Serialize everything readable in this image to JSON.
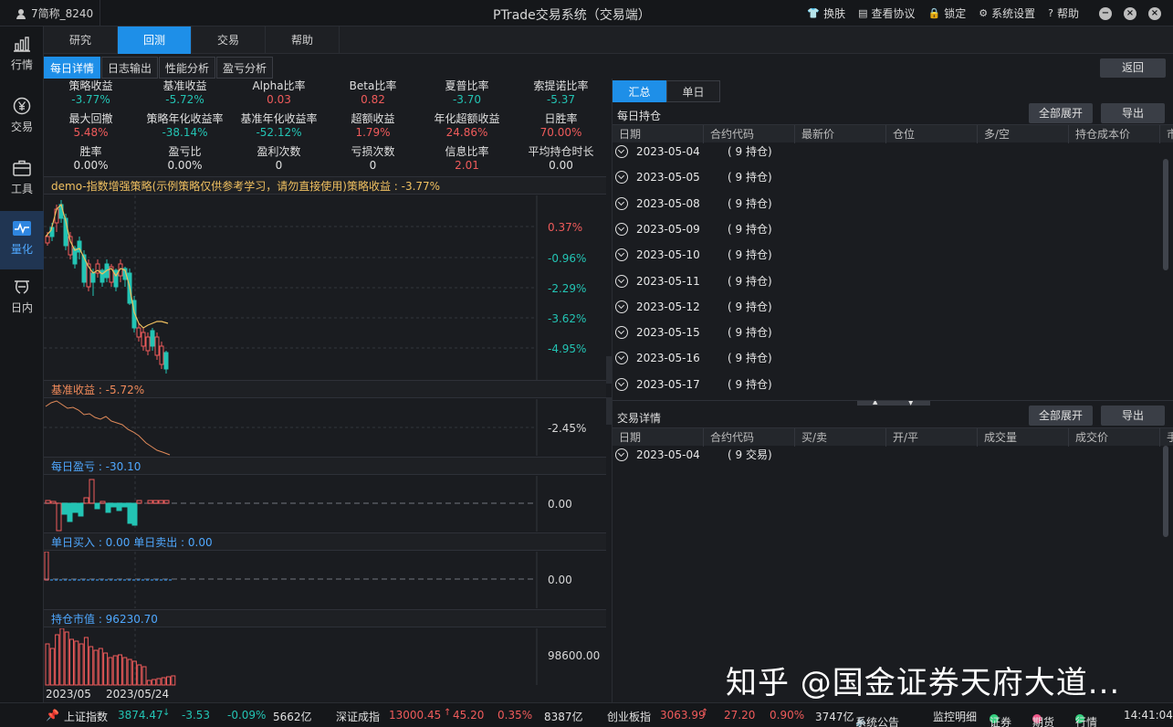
{
  "titlebar": {
    "user": "7简称_8240",
    "title": "PTrade交易系统（交易端）",
    "items": [
      {
        "icon": "shirt-icon",
        "label": "换肤"
      },
      {
        "icon": "document-icon",
        "label": "查看协议"
      },
      {
        "icon": "lock-icon",
        "label": "锁定"
      },
      {
        "icon": "gear-icon",
        "label": "系统设置"
      },
      {
        "icon": "help-icon",
        "label": "帮助"
      }
    ],
    "window_buttons": [
      "−",
      "×",
      "×"
    ]
  },
  "sidebar": [
    {
      "label": "行情",
      "icon": "bar-chart-icon"
    },
    {
      "label": "交易",
      "icon": "yen-icon"
    },
    {
      "label": "工具",
      "icon": "briefcase-icon"
    },
    {
      "label": "量化",
      "icon": "pulse-icon",
      "active": true
    },
    {
      "label": "日内",
      "icon": "intraday-icon"
    }
  ],
  "maintabs": [
    "研究",
    "回测",
    "交易",
    "帮助"
  ],
  "maintab_active": 1,
  "subtabs": [
    "每日详情",
    "日志输出",
    "性能分析",
    "盈亏分析"
  ],
  "return_label": "返回",
  "stats": [
    {
      "label": "策略收益",
      "value": "-3.77%",
      "color": "down"
    },
    {
      "label": "基准收益",
      "value": "-5.72%",
      "color": "down"
    },
    {
      "label": "Alpha比率",
      "value": "0.03",
      "color": "up"
    },
    {
      "label": "Beta比率",
      "value": "0.82",
      "color": "up"
    },
    {
      "label": "夏普比率",
      "value": "-3.70",
      "color": "down"
    },
    {
      "label": "索提诺比率",
      "value": "-5.37",
      "color": "down"
    },
    {
      "label": "最大回撤",
      "value": "5.48%",
      "color": "up"
    },
    {
      "label": "策略年化收益率",
      "value": "-38.14%",
      "color": "down"
    },
    {
      "label": "基准年化收益率",
      "value": "-52.12%",
      "color": "down"
    },
    {
      "label": "超额收益",
      "value": "1.79%",
      "color": "up"
    },
    {
      "label": "年化超额收益",
      "value": "24.86%",
      "color": "up"
    },
    {
      "label": "日胜率",
      "value": "70.00%",
      "color": "up"
    },
    {
      "label": "胜率",
      "value": "0.00%",
      "color": "neutral"
    },
    {
      "label": "盈亏比",
      "value": "0.00%",
      "color": "neutral"
    },
    {
      "label": "盈利次数",
      "value": "0",
      "color": "neutral"
    },
    {
      "label": "亏损次数",
      "value": "0",
      "color": "neutral"
    },
    {
      "label": "信息比率",
      "value": "2.01",
      "color": "up"
    },
    {
      "label": "平均持仓时长",
      "value": "0.00",
      "color": "neutral"
    }
  ],
  "charts": {
    "main_title": "demo-指数增强策略(示例策略仅供参考学习，请勿直接使用)策略收益 : -3.77%",
    "main_ticks": [
      "0.37%",
      "-0.96%",
      "-2.29%",
      "-3.62%",
      "-4.95%"
    ],
    "bench_title": "基准收益 : -5.72%",
    "bench_tick": "-2.45%",
    "pnl_title": "每日盈亏 : -30.10",
    "pnl_tick": "0.00",
    "trade_title": "单日买入 : 0.00  单日卖出 : 0.00",
    "trade_tick": "0.00",
    "hold_title": "持仓市值 : 96230.70",
    "hold_tick": "98600.00",
    "x_labels": [
      "2023/05",
      "2023/05/24"
    ]
  },
  "chart_data": {
    "type": "line",
    "title": "demo-指数增强策略(示例策略仅供参考学习，请勿直接使用)策略收益 : -3.77%",
    "x": [
      "2023/05",
      "2023/05/24"
    ],
    "series": [],
    "ytick_labels": [
      "0.37%",
      "-0.96%",
      "-2.29%",
      "-3.62%",
      "-4.95%"
    ]
  },
  "right": {
    "tabs": [
      "汇总",
      "单日"
    ],
    "holdings_title": "每日持仓",
    "expand_all": "全部展开",
    "export": "导出",
    "holdings_headers": [
      "日期",
      "合约代码",
      "最新价",
      "仓位",
      "多/空",
      "持仓成本价",
      "市"
    ],
    "holdings_rows": [
      {
        "date": "2023-05-04",
        "count": "( 9 持仓)"
      },
      {
        "date": "2023-05-05",
        "count": "( 9 持仓)"
      },
      {
        "date": "2023-05-08",
        "count": "( 9 持仓)"
      },
      {
        "date": "2023-05-09",
        "count": "( 9 持仓)"
      },
      {
        "date": "2023-05-10",
        "count": "( 9 持仓)"
      },
      {
        "date": "2023-05-11",
        "count": "( 9 持仓)"
      },
      {
        "date": "2023-05-12",
        "count": "( 9 持仓)"
      },
      {
        "date": "2023-05-15",
        "count": "( 9 持仓)"
      },
      {
        "date": "2023-05-16",
        "count": "( 9 持仓)"
      },
      {
        "date": "2023-05-17",
        "count": "( 9 持仓)"
      }
    ],
    "trades_title": "交易详情",
    "trades_headers": [
      "日期",
      "合约代码",
      "买/卖",
      "开/平",
      "成交量",
      "成交价",
      "手"
    ],
    "trades_rows": [
      {
        "date": "2023-05-04",
        "count": "( 9 交易)"
      }
    ]
  },
  "footer": {
    "sh_label": "上证指数",
    "sh_price": "3874.47",
    "sh_chg": "-3.53",
    "sh_pct": "-0.09%",
    "sh_vol": "5662亿",
    "sz_label": "深证成指",
    "sz_price": "13000.45",
    "sz_chg": "45.20",
    "sz_pct": "0.35%",
    "sz_vol": "8387亿",
    "cy_label": "创业板指",
    "cy_price": "3063.99",
    "cy_chg": "27.20",
    "cy_pct": "0.90%",
    "cy_vol": "3747亿",
    "notice": "系统公告",
    "monitor": "监控明细",
    "zq": "证券",
    "qh": "期货",
    "hq": "行情",
    "time": "14:41:04"
  },
  "watermark": "知乎 @国金证券天府大道..."
}
